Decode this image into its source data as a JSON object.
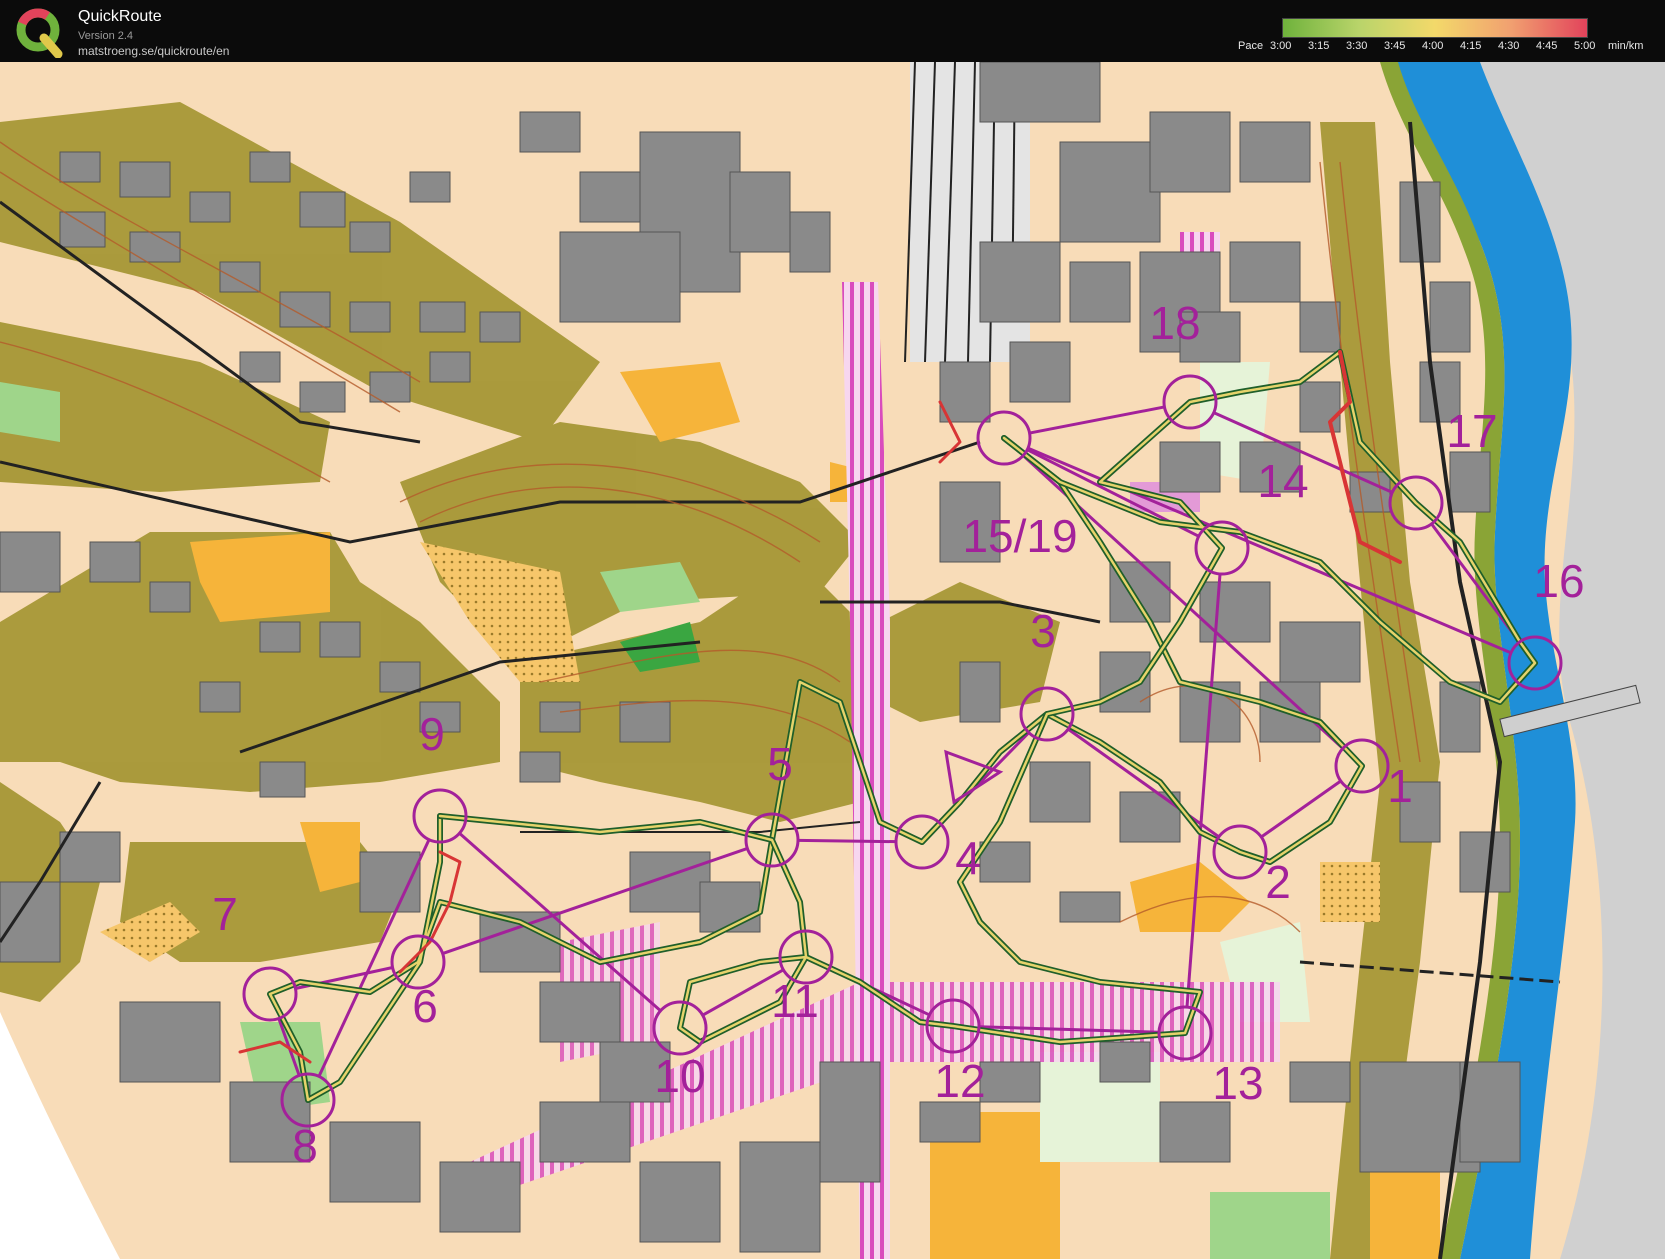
{
  "app": {
    "title": "QuickRoute",
    "version": "Version 2.4",
    "url": "matstroeng.se/quickroute/en"
  },
  "legend": {
    "pace_label": "Pace",
    "unit": "min/km",
    "ticks": [
      "3:00",
      "3:15",
      "3:30",
      "3:45",
      "4:00",
      "4:15",
      "4:30",
      "4:45",
      "5:00"
    ],
    "gradient_colors": [
      "#6fb23c",
      "#b9d46a",
      "#f3d96a",
      "#f1a070",
      "#e2435b"
    ]
  },
  "colors": {
    "course": "#a3219a",
    "route_outer": "#1f5f2a",
    "route_inner": "#e6d36b",
    "route_red": "#d83535",
    "water": "#1f8fd8",
    "building": "#8a8a8a",
    "open_land": "#f8dcb8",
    "forest_olive": "#9f8f33",
    "yellow_field": "#f6b43a",
    "green_park": "#3aa641",
    "pedestrian": "#e39ad7"
  },
  "controls": [
    {
      "label": "1"
    },
    {
      "label": "2"
    },
    {
      "label": "3"
    },
    {
      "label": "4"
    },
    {
      "label": "5"
    },
    {
      "label": "6"
    },
    {
      "label": "7"
    },
    {
      "label": "8"
    },
    {
      "label": "9"
    },
    {
      "label": "10"
    },
    {
      "label": "11"
    },
    {
      "label": "12"
    },
    {
      "label": "13"
    },
    {
      "label": "14"
    },
    {
      "label": "15/19"
    },
    {
      "label": "16"
    },
    {
      "label": "17"
    },
    {
      "label": "18"
    }
  ]
}
